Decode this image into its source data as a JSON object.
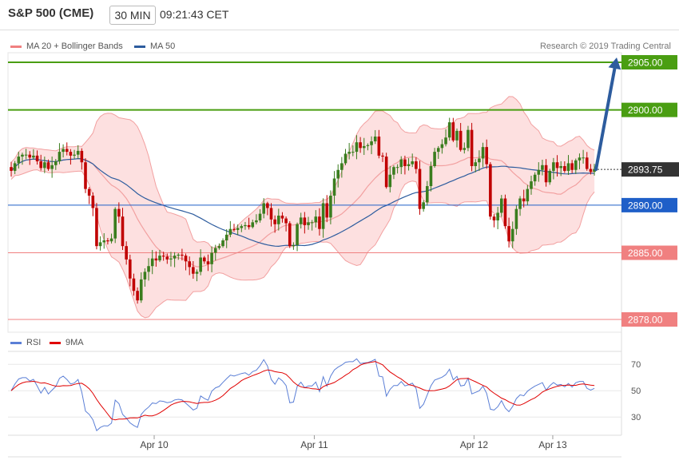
{
  "header": {
    "title": "S&P 500 (CME)",
    "timeframe": "30 MIN",
    "time": "09:21:43 CET"
  },
  "legend": {
    "bollinger": "MA 20 + Bollinger Bands",
    "ma50": "MA 50",
    "credit": "Research © 2019 Trading Central",
    "rsi": "RSI",
    "rsi_ma": "9MA"
  },
  "colors": {
    "up": "#3a7d1e",
    "down": "#c00000",
    "band_fill": "#fde0e0",
    "band_line": "#f2a0a0",
    "ma50": "#2d5c9e",
    "resistance": "#4a9e12",
    "support": "#f08080",
    "pivot": "#1f5fc8",
    "arrow": "#2d5c9e",
    "rsi": "#5b7fd6",
    "rsi_ma": "#e00000"
  },
  "chart_data": [
    {
      "type": "candlestick",
      "ylim": [
        1877.7,
        2906.6
      ],
      "levels": [
        {
          "value": 2905.0,
          "label": "2905.00",
          "kind": "resistance"
        },
        {
          "value": 2900.0,
          "label": "2900.00",
          "kind": "resistance"
        },
        {
          "value": 2890.0,
          "label": "2890.00",
          "kind": "pivot"
        },
        {
          "value": 2885.0,
          "label": "2885.00",
          "kind": "support"
        },
        {
          "value": 2878.0,
          "label": "2878.00",
          "kind": "support"
        }
      ],
      "current_price": {
        "value": 2893.75,
        "label": "2893.75"
      },
      "forecast_target": 2905.5,
      "x_labels": [
        {
          "label": "Apr 10",
          "bar": 38.5
        },
        {
          "label": "Apr 11",
          "bar": 81.6
        },
        {
          "label": "Apr 12",
          "bar": 124.6
        },
        {
          "label": "Apr 13",
          "bar": 145.8
        }
      ],
      "closes": [
        2893.6,
        2894.4,
        2895.1,
        2895.3,
        2895.3,
        2895.0,
        2895.2,
        2894.6,
        2893.9,
        2894.5,
        2893.8,
        2894.2,
        2894.6,
        2895.6,
        2895.9,
        2895.6,
        2895.2,
        2895.3,
        2895.7,
        2894.5,
        2891.7,
        2891.0,
        2889.7,
        2885.7,
        2886.1,
        2886.3,
        2886.2,
        2886.5,
        2889.6,
        2888.8,
        2885.7,
        2884.3,
        2882.3,
        2881.0,
        2880.0,
        2882.2,
        2883.0,
        2883.6,
        2884.4,
        2884.2,
        2884.7,
        2884.6,
        2884.3,
        2884.4,
        2884.7,
        2884.8,
        2884.7,
        2884.1,
        2883.5,
        2882.8,
        2883.0,
        2884.5,
        2884.1,
        2883.8,
        2885.0,
        2885.5,
        2885.7,
        2886.3,
        2886.9,
        2887.5,
        2887.4,
        2887.6,
        2887.8,
        2887.9,
        2887.7,
        2888.2,
        2888.4,
        2889.1,
        2890.2,
        2889.7,
        2888.5,
        2888.0,
        2888.9,
        2888.6,
        2888.1,
        2885.7,
        2885.8,
        2888.0,
        2888.7,
        2887.9,
        2888.2,
        2888.2,
        2888.8,
        2887.5,
        2890.2,
        2888.7,
        2891.0,
        2892.8,
        2893.7,
        2894.4,
        2895.4,
        2895.6,
        2895.6,
        2896.6,
        2896.0,
        2896.2,
        2896.3,
        2896.7,
        2897.2,
        2895.2,
        2895.1,
        2891.9,
        2893.2,
        2894.0,
        2894.0,
        2894.8,
        2894.1,
        2894.3,
        2894.6,
        2893.8,
        2889.6,
        2890.3,
        2892.0,
        2894.1,
        2895.6,
        2896.0,
        2896.4,
        2897.1,
        2898.7,
        2896.8,
        2897.8,
        2895.8,
        2896.0,
        2897.9,
        2894.1,
        2894.5,
        2894.9,
        2896.1,
        2894.3,
        2888.8,
        2888.4,
        2889.2,
        2890.7,
        2887.8,
        2886.2,
        2887.5,
        2889.6,
        2890.7,
        2890.4,
        2891.7,
        2892.5,
        2893.2,
        2893.7,
        2894.2,
        2892.4,
        2893.6,
        2894.5,
        2893.9,
        2894.1,
        2893.6,
        2894.4,
        2893.7,
        2894.7,
        2895.0,
        2895.0,
        2893.8,
        2893.5,
        2893.8
      ],
      "rsi": {
        "levels": [
          30,
          50,
          70
        ],
        "ylim": [
          18,
          78
        ]
      }
    }
  ]
}
